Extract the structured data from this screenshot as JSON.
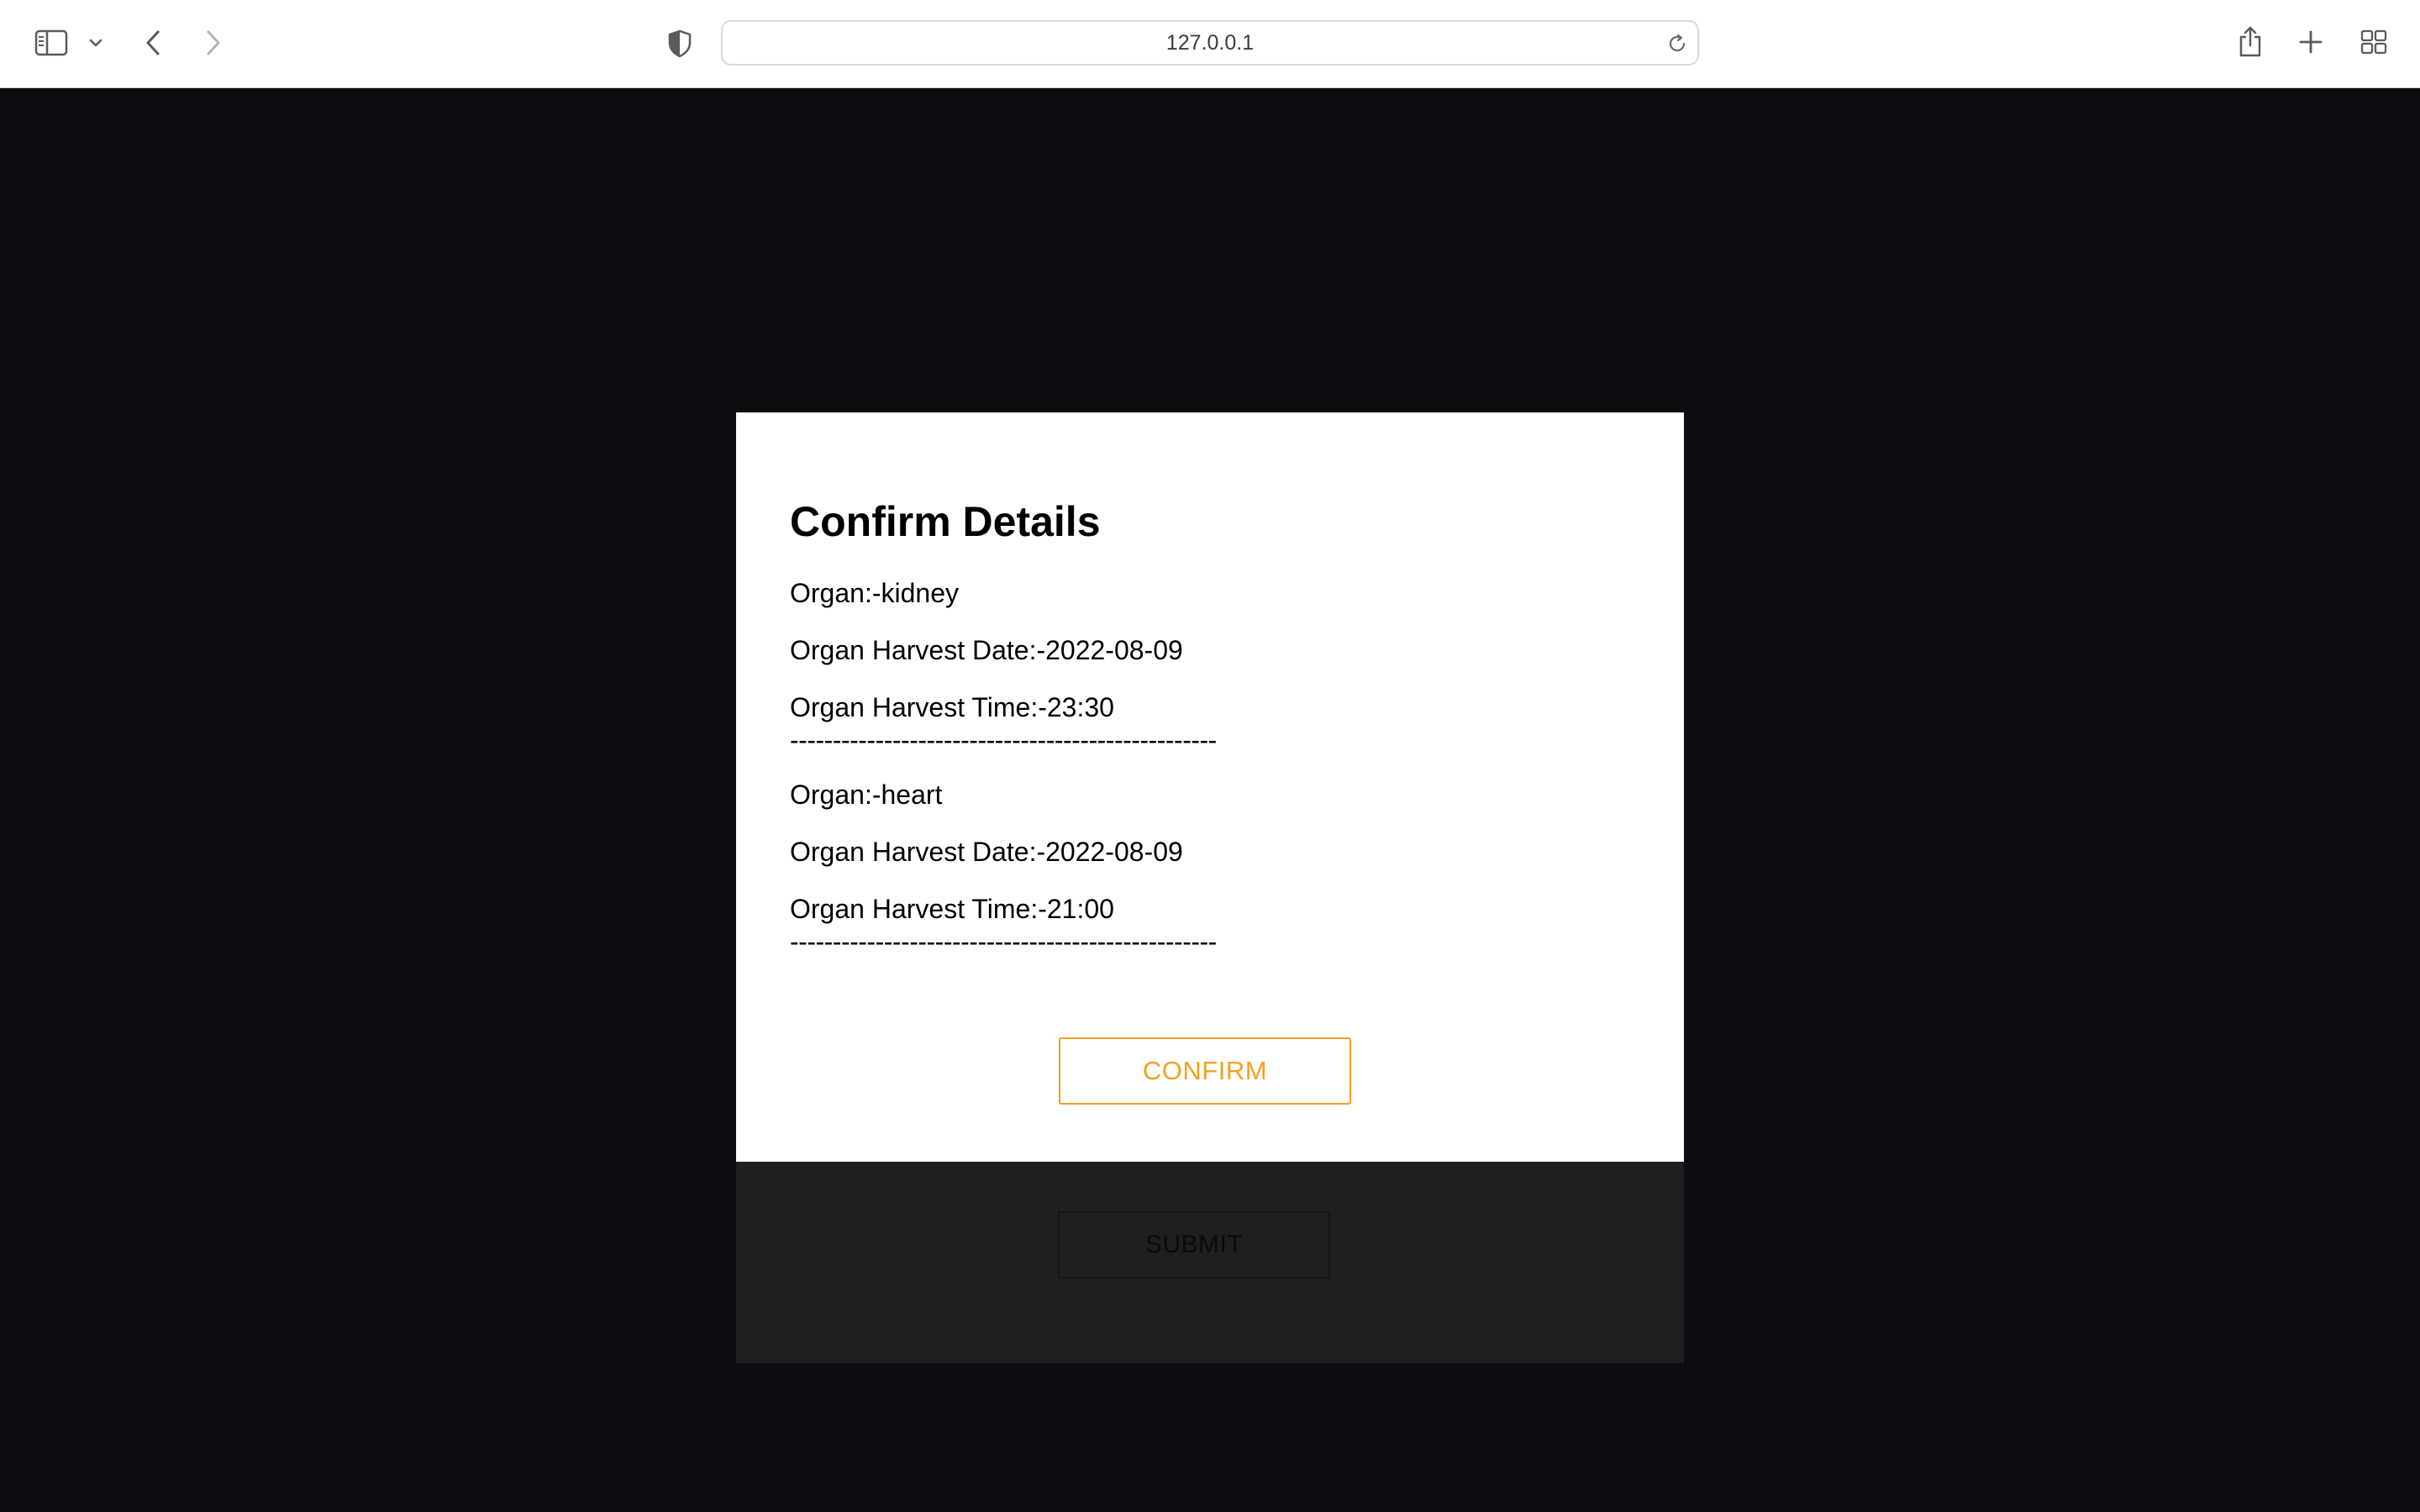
{
  "browser": {
    "url": "127.0.0.1",
    "icons": {
      "sidebar": "sidebar-icon",
      "sidebar_menu": "chevron-down-icon",
      "back": "back-icon",
      "forward": "forward-icon",
      "privacy": "shield-icon",
      "reload": "reload-icon",
      "share": "share-icon",
      "new_tab": "plus-icon",
      "tab_overview": "grid-icon"
    }
  },
  "background_page": {
    "submit_label": "SUBMIT"
  },
  "modal": {
    "title": "Confirm Details",
    "entries": [
      {
        "organ": "Organ:-kidney",
        "date": "Organ Harvest Date:-2022-08-09",
        "time": "Organ Harvest Time:-23:30",
        "separator": "--------------------------------------------------"
      },
      {
        "organ": "Organ:-heart",
        "date": "Organ Harvest Date:-2022-08-09",
        "time": "Organ Harvest Time:-21:00",
        "separator": "--------------------------------------------------"
      }
    ],
    "confirm_label": "CONFIRM"
  },
  "colors": {
    "accent": "#f2a11f",
    "overlay": "#0c0d10",
    "modal_bg": "#ffffff"
  }
}
